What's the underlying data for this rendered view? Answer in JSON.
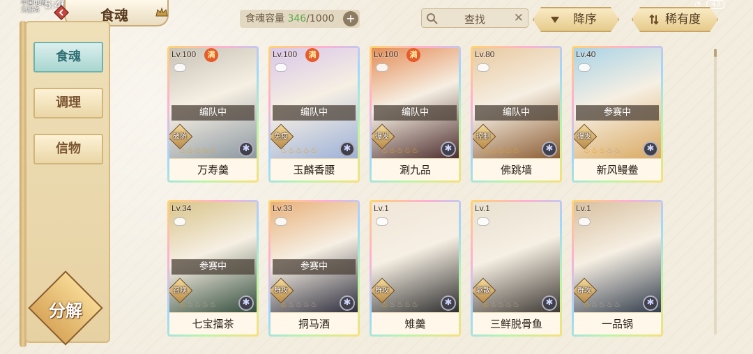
{
  "status_bar": {
    "carrier_line1": "中国电信",
    "carrier_line2": "无服务",
    "time": "5:46",
    "battery": "43"
  },
  "header": {
    "title": "食魂"
  },
  "capacity": {
    "label": "食魂容量",
    "current": "346",
    "max": "/1000"
  },
  "search": {
    "label": "查找"
  },
  "sort": {
    "order_label": "降序",
    "rarity_label": "稀有度"
  },
  "sidebar": {
    "items": [
      {
        "label": "食魂",
        "active": true
      },
      {
        "label": "调理",
        "active": false
      },
      {
        "label": "信物",
        "active": false
      }
    ],
    "decompose_label": "分解"
  },
  "max_badge": "满",
  "cards": [
    {
      "level": "Lv.100",
      "max": true,
      "status": "编队中",
      "role": "破防",
      "stars": 5,
      "name": "万寿羹",
      "colors": [
        "#c8c2b6",
        "#8a96a0"
      ]
    },
    {
      "level": "Lv.100",
      "max": true,
      "status": "编队中",
      "role": "免疫",
      "stars": 5,
      "name": "玉麟香腰",
      "colors": [
        "#d9c6e8",
        "#9bb0d8"
      ]
    },
    {
      "level": "Lv.100",
      "max": true,
      "status": "编队中",
      "role": "爆发",
      "stars": 5,
      "name": "涮九品",
      "colors": [
        "#e48b55",
        "#4a2a2a"
      ]
    },
    {
      "level": "Lv.80",
      "max": false,
      "status": "编队中",
      "role": "控制",
      "stars": 5,
      "name": "佛跳墙",
      "colors": [
        "#e8c9a0",
        "#8a5a30"
      ]
    },
    {
      "level": "Lv.40",
      "max": false,
      "status": "参赛中",
      "role": "爆发",
      "stars": 3,
      "name": "新风鳗鲞",
      "colors": [
        "#a9d3e6",
        "#d9a860"
      ]
    },
    {
      "level": "Lv.34",
      "max": false,
      "status": "参赛中",
      "role": "召唤",
      "stars": 1,
      "name": "七宝擂茶",
      "colors": [
        "#d9c48a",
        "#2f4a3a"
      ]
    },
    {
      "level": "Lv.33",
      "max": false,
      "status": "参赛中",
      "role": "群攻",
      "stars": 1,
      "name": "挏马酒",
      "colors": [
        "#e8b07a",
        "#2a2a3a"
      ]
    },
    {
      "level": "Lv.1",
      "max": false,
      "status": "",
      "role": "群攻",
      "stars": 1,
      "name": "雉羹",
      "colors": [
        "#f0e6d8",
        "#2a2a2a"
      ]
    },
    {
      "level": "Lv.1",
      "max": false,
      "status": "",
      "role": "驱散",
      "stars": 1,
      "name": "三鲜脱骨鱼",
      "colors": [
        "#e8e0d0",
        "#3a3530"
      ]
    },
    {
      "level": "Lv.1",
      "max": false,
      "status": "",
      "role": "群攻",
      "stars": 1,
      "name": "一品锅",
      "colors": [
        "#d8c0a0",
        "#2f3a4a"
      ]
    }
  ],
  "flame_glyph": "♨",
  "icons": [
    "back-icon",
    "crown-icon",
    "search-icon",
    "clear-icon",
    "sort-down-icon",
    "sort-arrows-icon",
    "chat-icon",
    "element-icon"
  ]
}
